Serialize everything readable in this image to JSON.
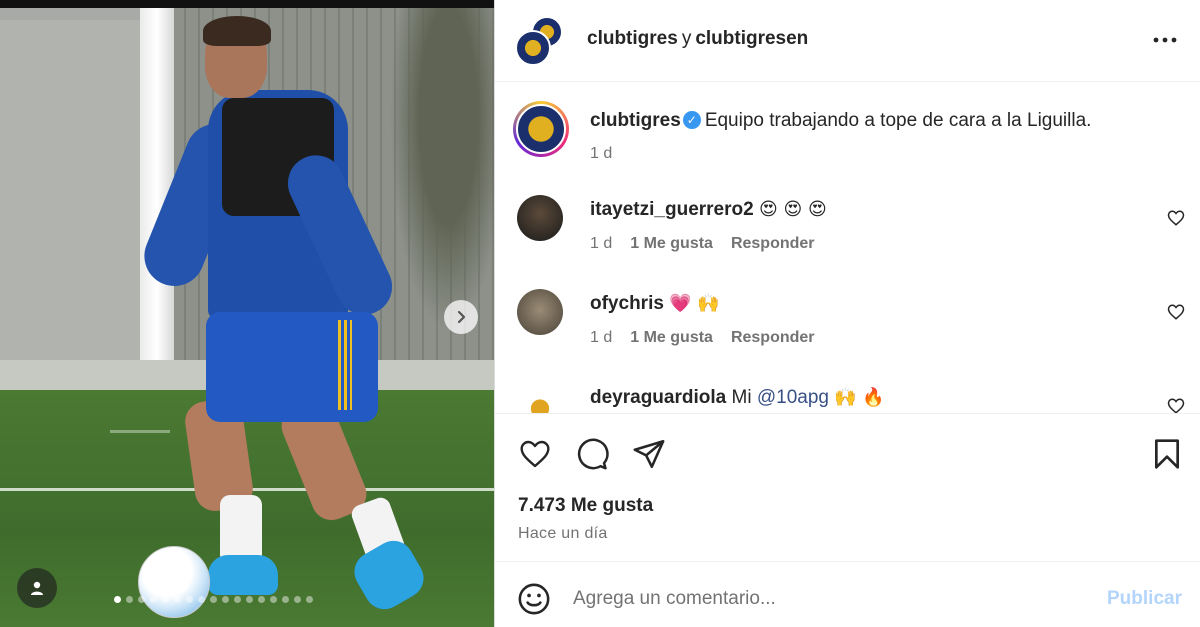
{
  "colors": {
    "accent": "#0095f6",
    "publish_disabled": "#b3d4fb",
    "secondary_text": "#737373",
    "verified": "#3897f0"
  },
  "photo": {
    "carousel_current_index": 1,
    "carousel_total": 17
  },
  "header": {
    "user1": "clubtigres",
    "joiner": "y",
    "user2": "clubtigresen",
    "more_icon": "more-horizontal-icon"
  },
  "caption": {
    "username": "clubtigres",
    "verified_icon": "verified-badge-icon",
    "text": "Equipo trabajando a tope de cara a la Liguilla.",
    "time": "1 d"
  },
  "comments": [
    {
      "username": "itayetzi_guerrero2",
      "text": "😍 😍 😍",
      "time": "1 d",
      "likes": "1 Me gusta",
      "reply": "Responder"
    },
    {
      "username": "ofychris",
      "text": "💗 🙌",
      "time": "1 d",
      "likes": "1 Me gusta",
      "reply": "Responder"
    },
    {
      "username": "deyraguardiola",
      "text_prefix": "Mi",
      "mention": "@10apg",
      "text_suffix": "🙌 🔥"
    }
  ],
  "actions": {
    "like_icon": "heart-icon",
    "comment_icon": "comment-icon",
    "share_icon": "send-icon",
    "save_icon": "bookmark-icon"
  },
  "likes_count": "7.473 Me gusta",
  "time_ago": "Hace un día",
  "comment_box": {
    "placeholder": "Agrega un comentario...",
    "publish_label": "Publicar"
  }
}
